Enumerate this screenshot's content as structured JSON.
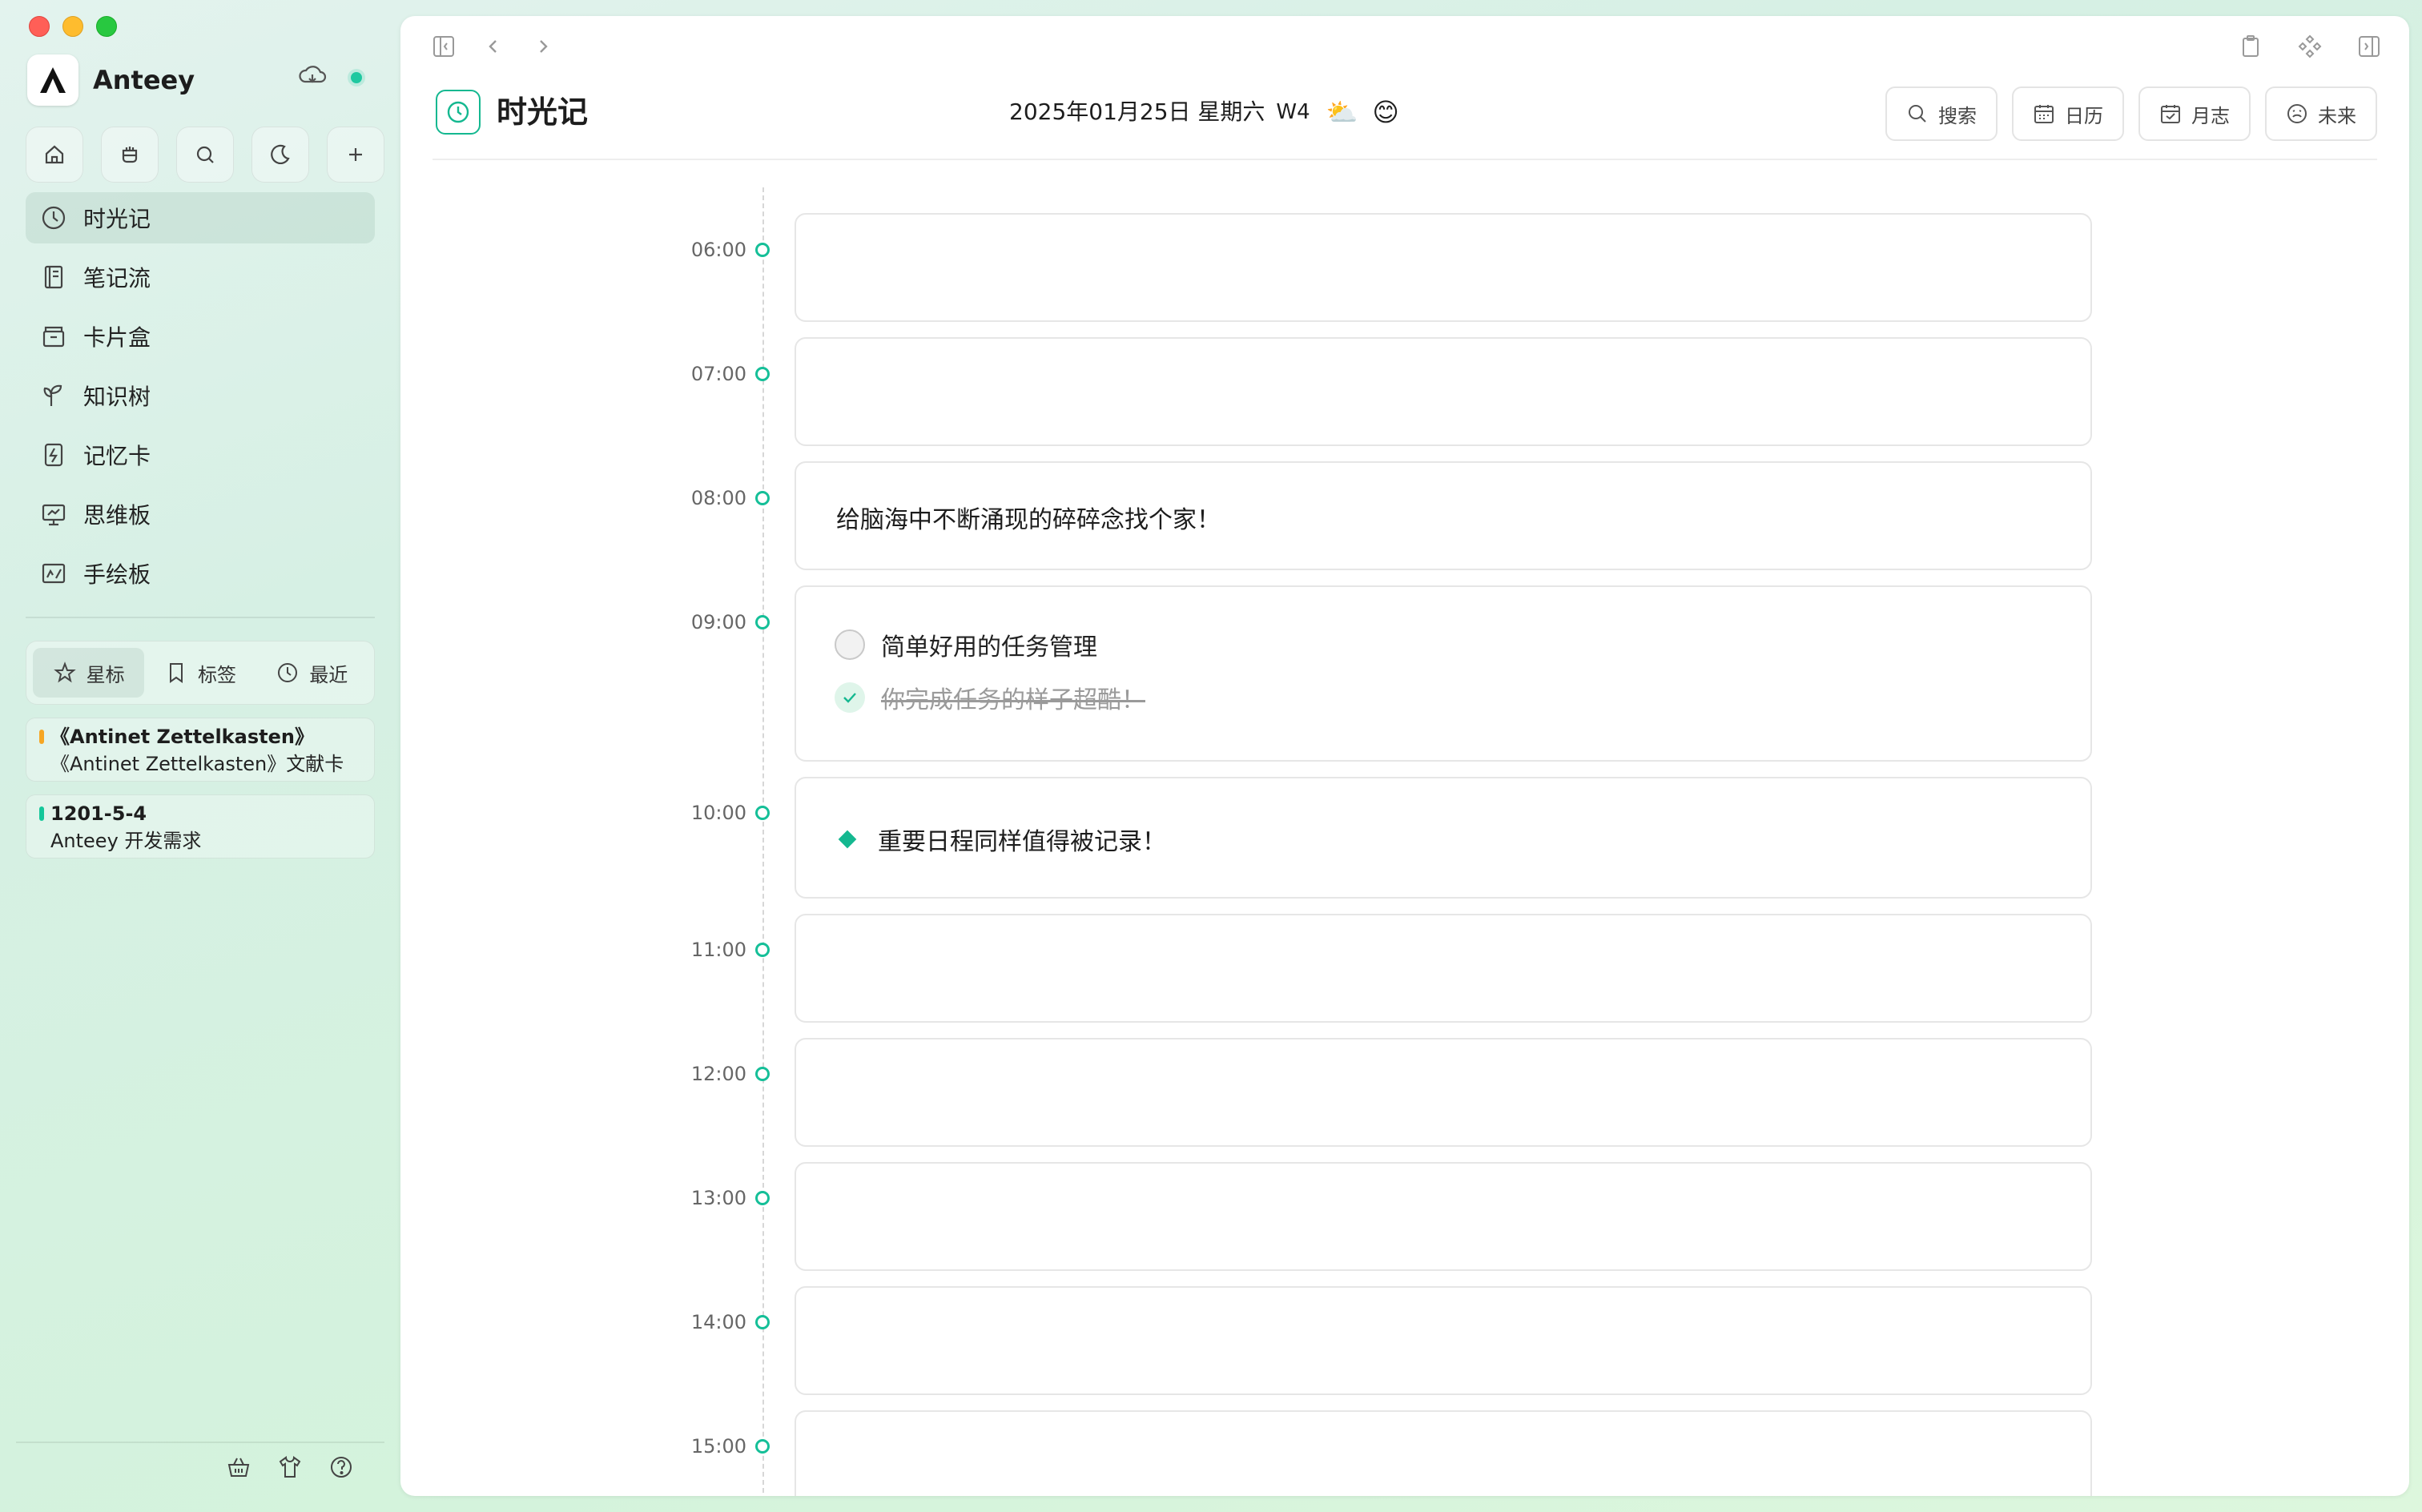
{
  "app": {
    "name": "Anteey"
  },
  "sidebar": {
    "nav": [
      {
        "label": "时光记",
        "icon": "clock-icon"
      },
      {
        "label": "笔记流",
        "icon": "notebook-icon"
      },
      {
        "label": "卡片盒",
        "icon": "card-box-icon"
      },
      {
        "label": "知识树",
        "icon": "sprout-icon"
      },
      {
        "label": "记忆卡",
        "icon": "flashcard-icon"
      },
      {
        "label": "思维板",
        "icon": "whiteboard-icon"
      },
      {
        "label": "手绘板",
        "icon": "sketch-icon"
      }
    ],
    "segments": [
      {
        "label": "星标",
        "icon": "star-icon"
      },
      {
        "label": "标签",
        "icon": "bookmark-icon"
      },
      {
        "label": "最近",
        "icon": "clock-icon"
      }
    ],
    "favorites": [
      {
        "title": "《Antinet Zettelkasten》",
        "subtitle": "《Antinet Zettelkasten》文献卡",
        "color": "#f6a623"
      },
      {
        "title": "1201-5-4",
        "subtitle": "Anteey 开发需求",
        "color": "#14c79a"
      }
    ]
  },
  "header": {
    "title": "时光记",
    "date": "2025年01月25日 星期六",
    "week": "W4",
    "weather": "⛅",
    "mood": "😊",
    "actions": [
      {
        "label": "搜索",
        "icon": "search-icon"
      },
      {
        "label": "日历",
        "icon": "calendar-icon"
      },
      {
        "label": "月志",
        "icon": "calendar-check-icon"
      },
      {
        "label": "未来",
        "icon": "future-icon"
      }
    ]
  },
  "timeline": {
    "slots": [
      {
        "time": "06:00"
      },
      {
        "time": "07:00"
      },
      {
        "time": "08:00",
        "note": "给脑海中不断涌现的碎碎念找个家！"
      },
      {
        "time": "09:00",
        "tasks": [
          {
            "text": "简单好用的任务管理",
            "done": false
          },
          {
            "text": "你完成任务的样子超酷！",
            "done": true
          }
        ]
      },
      {
        "time": "10:00",
        "schedule": "重要日程同样值得被记录！"
      },
      {
        "time": "11:00"
      },
      {
        "time": "12:00"
      },
      {
        "time": "13:00"
      },
      {
        "time": "14:00"
      },
      {
        "time": "15:00"
      }
    ]
  },
  "colors": {
    "accent": "#14b890"
  }
}
